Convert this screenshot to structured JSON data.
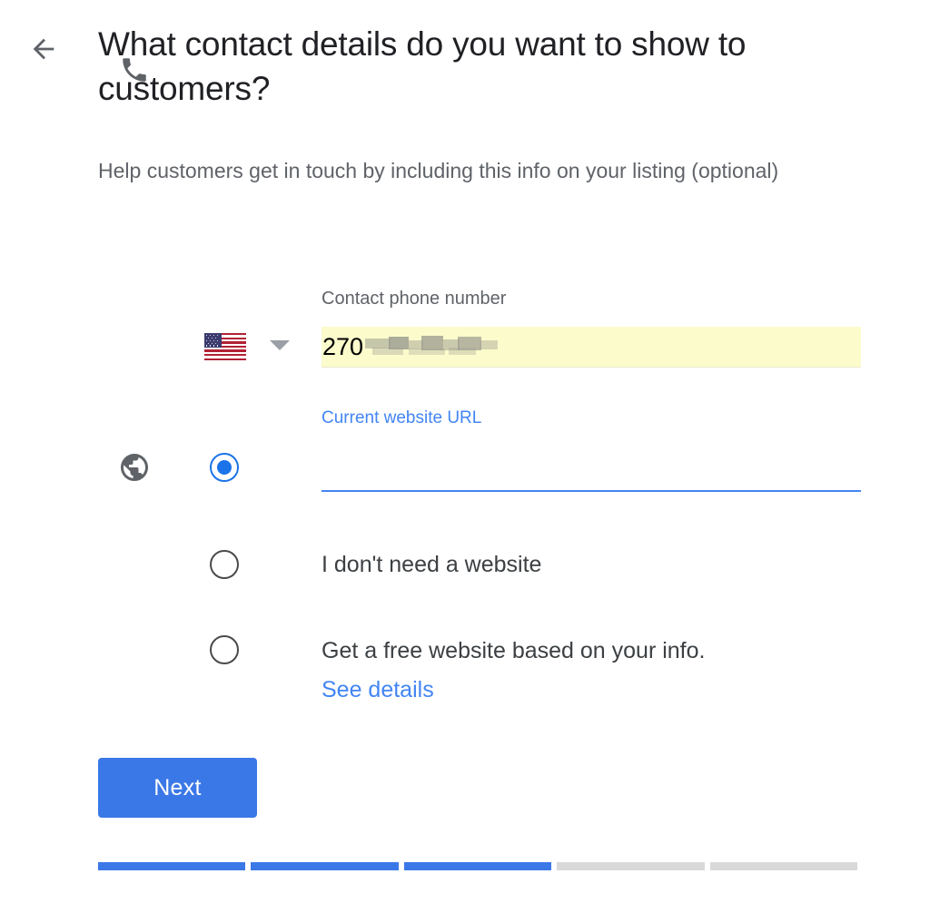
{
  "header": {
    "back_icon": "back-arrow-icon",
    "title": "What contact details do you want to show to customers?",
    "subtitle": "Help customers get in touch by including this info on your listing (optional)"
  },
  "phone_section": {
    "icon": "phone-icon",
    "country_flag": "us-flag-icon",
    "country_dropdown_icon": "chevron-down-icon",
    "label": "Contact phone number",
    "value": "270",
    "value_redacted": true
  },
  "website_section": {
    "icon": "globe-icon",
    "options": [
      {
        "id": "current-url",
        "selected": true,
        "label": "Current website URL",
        "has_input": true,
        "input_value": "",
        "input_redacted": true
      },
      {
        "id": "no-website",
        "selected": false,
        "label": "I don't need a website",
        "has_input": false
      },
      {
        "id": "free-website",
        "selected": false,
        "label": "Get a free website based on your info.",
        "link_label": "See details",
        "has_input": false
      }
    ]
  },
  "actions": {
    "next_label": "Next"
  },
  "progress": {
    "total_steps": 5,
    "completed_steps": 3
  },
  "colors": {
    "accent_blue": "#3b78e7",
    "link_blue": "#4285f4",
    "radio_blue": "#1a73e8",
    "autofill_yellow": "#fbfbcc",
    "text_primary": "#202124",
    "text_secondary": "#5f6368",
    "progress_empty": "#d9d9d9"
  }
}
